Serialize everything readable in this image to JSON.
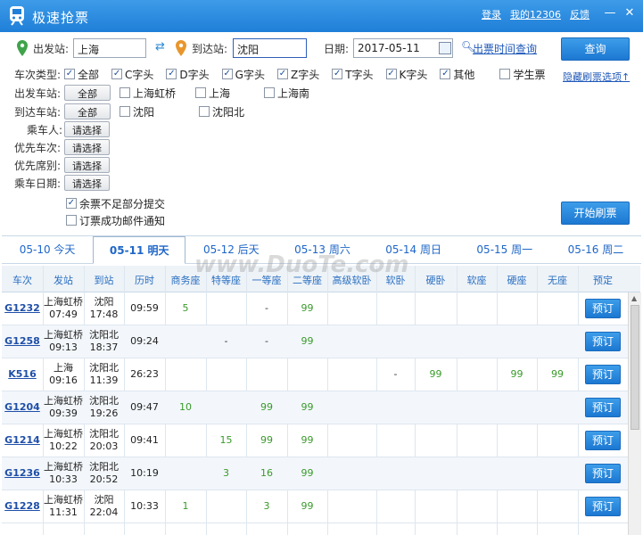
{
  "window": {
    "title": "极速抢票",
    "links": [
      "登录",
      "我的12306",
      "反馈"
    ],
    "minimize": "—",
    "close": "✕"
  },
  "search": {
    "from_label": "出发站:",
    "from_value": "上海",
    "to_label": "到达站:",
    "to_value": "沈阳",
    "date_label": "日期:",
    "date_value": "2017-05-11",
    "ticket_time_link": "出票时间查询",
    "query_button": "查询"
  },
  "filters": {
    "type_label": "车次类型:",
    "types": [
      {
        "label": "全部",
        "checked": true
      },
      {
        "label": "C字头",
        "checked": true
      },
      {
        "label": "D字头",
        "checked": true
      },
      {
        "label": "G字头",
        "checked": true
      },
      {
        "label": "Z字头",
        "checked": true
      },
      {
        "label": "T字头",
        "checked": true
      },
      {
        "label": "K字头",
        "checked": true
      },
      {
        "label": "其他",
        "checked": true
      },
      {
        "label": "学生票",
        "checked": false
      }
    ],
    "hide_link": "隐藏刷票选项↑",
    "depart_label": "出发车站:",
    "depart_all": "全部",
    "depart_stations": [
      "上海虹桥",
      "上海",
      "上海南"
    ],
    "arrive_label": "到达车站:",
    "arrive_all": "全部",
    "arrive_stations": [
      "沈阳",
      "沈阳北"
    ],
    "passenger_label": "乘车人:",
    "train_pref_label": "优先车次:",
    "seat_pref_label": "优先席别:",
    "date_pref_label": "乘车日期:",
    "choose": "请选择",
    "partial_submit": "余票不足部分提交",
    "partial_checked": true,
    "email_notify": "订票成功邮件通知",
    "email_checked": false,
    "start_button": "开始刷票"
  },
  "date_tabs": [
    {
      "label": "05-10 今天",
      "selected": false
    },
    {
      "label": "05-11 明天",
      "selected": true
    },
    {
      "label": "05-12 后天",
      "selected": false
    },
    {
      "label": "05-13 周六",
      "selected": false
    },
    {
      "label": "05-14 周日",
      "selected": false
    },
    {
      "label": "05-15 周一",
      "selected": false
    },
    {
      "label": "05-16 周二",
      "selected": false
    }
  ],
  "table": {
    "headers": [
      "车次",
      "发站",
      "到站",
      "历时",
      "商务座",
      "特等座",
      "一等座",
      "二等座",
      "高级软卧",
      "软卧",
      "硬卧",
      "软座",
      "硬座",
      "无座",
      "预定"
    ],
    "book_label": "预订",
    "rows": [
      {
        "train": "G1232",
        "from": "上海虹桥",
        "dep": "07:49",
        "to": "沈阳",
        "arr": "17:48",
        "dur": "09:59",
        "seats": [
          "5",
          "",
          "-",
          "99",
          "",
          "",
          "",
          "",
          "",
          ""
        ]
      },
      {
        "train": "G1258",
        "from": "上海虹桥",
        "dep": "09:13",
        "to": "沈阳北",
        "arr": "18:37",
        "dur": "09:24",
        "seats": [
          "",
          "-",
          "-",
          "99",
          "",
          "",
          "",
          "",
          "",
          ""
        ]
      },
      {
        "train": "K516",
        "from": "上海",
        "dep": "09:16",
        "to": "沈阳北",
        "arr": "11:39",
        "dur": "26:23",
        "seats": [
          "",
          "",
          "",
          "",
          "",
          "-",
          "99",
          "",
          "99",
          "99"
        ]
      },
      {
        "train": "G1204",
        "from": "上海虹桥",
        "dep": "09:39",
        "to": "沈阳北",
        "arr": "19:26",
        "dur": "09:47",
        "seats": [
          "10",
          "",
          "99",
          "99",
          "",
          "",
          "",
          "",
          "",
          ""
        ]
      },
      {
        "train": "G1214",
        "from": "上海虹桥",
        "dep": "10:22",
        "to": "沈阳北",
        "arr": "20:03",
        "dur": "09:41",
        "seats": [
          "",
          "15",
          "99",
          "99",
          "",
          "",
          "",
          "",
          "",
          ""
        ]
      },
      {
        "train": "G1236",
        "from": "上海虹桥",
        "dep": "10:33",
        "to": "沈阳北",
        "arr": "20:52",
        "dur": "10:19",
        "seats": [
          "",
          "3",
          "16",
          "99",
          "",
          "",
          "",
          "",
          "",
          ""
        ]
      },
      {
        "train": "G1228",
        "from": "上海虹桥",
        "dep": "11:31",
        "to": "沈阳",
        "arr": "22:04",
        "dur": "10:33",
        "seats": [
          "1",
          "",
          "3",
          "99",
          "",
          "",
          "",
          "",
          "",
          ""
        ]
      }
    ]
  },
  "watermark": "www.DuoTe.com"
}
